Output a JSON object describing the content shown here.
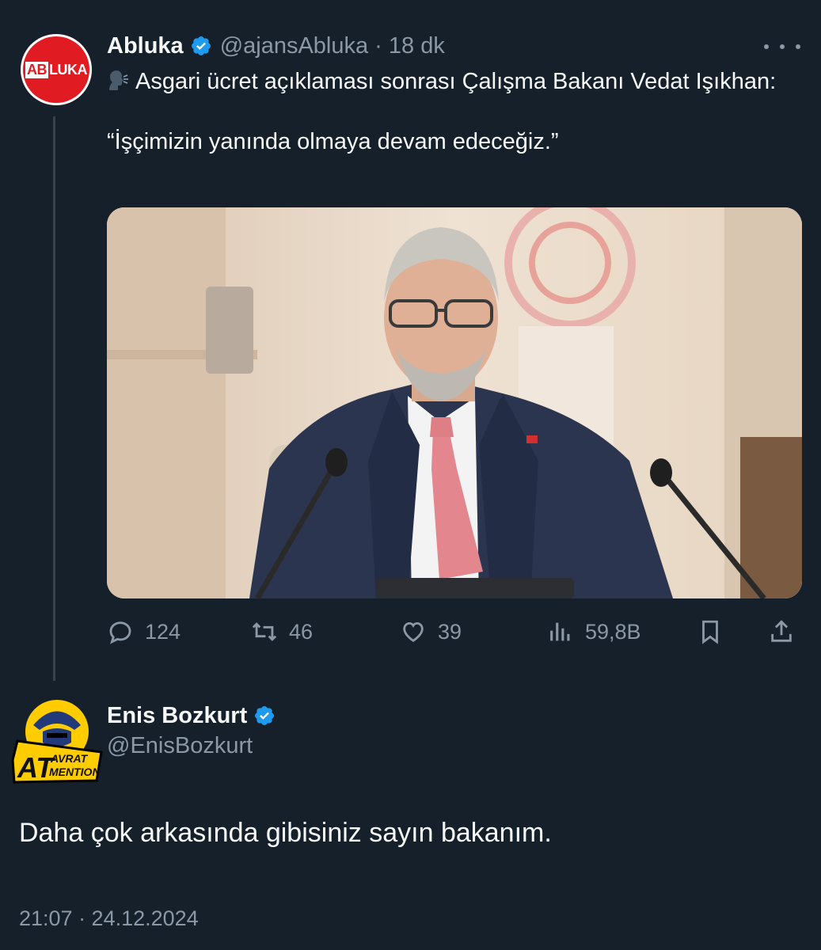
{
  "tweet": {
    "author_name": "Abluka",
    "author_handle": "@ajansAbluka · 18 dk",
    "avatar_logo_a": "AB",
    "avatar_logo_b": "LUKA",
    "text_line1": "Asgari ücret açıklaması sonrası Çalışma Bakanı Vedat Işıkhan:",
    "text_quote": "“İşçimizin yanında olmaya devam edeceğiz.”",
    "emoji_icon": "speaking-head-icon",
    "stats": {
      "replies": "124",
      "retweets": "46",
      "likes": "39",
      "views": "59,8B"
    }
  },
  "reply": {
    "author_name": "Enis Bozkurt",
    "author_handle": "@EnisBozkurt",
    "avatar_text_a": "AT",
    "avatar_text_b": "AVRAT",
    "avatar_text_c": "MENTION",
    "text": "Daha çok arkasında gibisiniz sayın bakanım.",
    "timestamp": "21:07 · 24.12.2024"
  },
  "colors": {
    "background": "#15202b",
    "text": "#f7f9f9",
    "secondary": "#8b98a5",
    "verified": "#1d9bf0",
    "thread_line": "#38444d"
  }
}
